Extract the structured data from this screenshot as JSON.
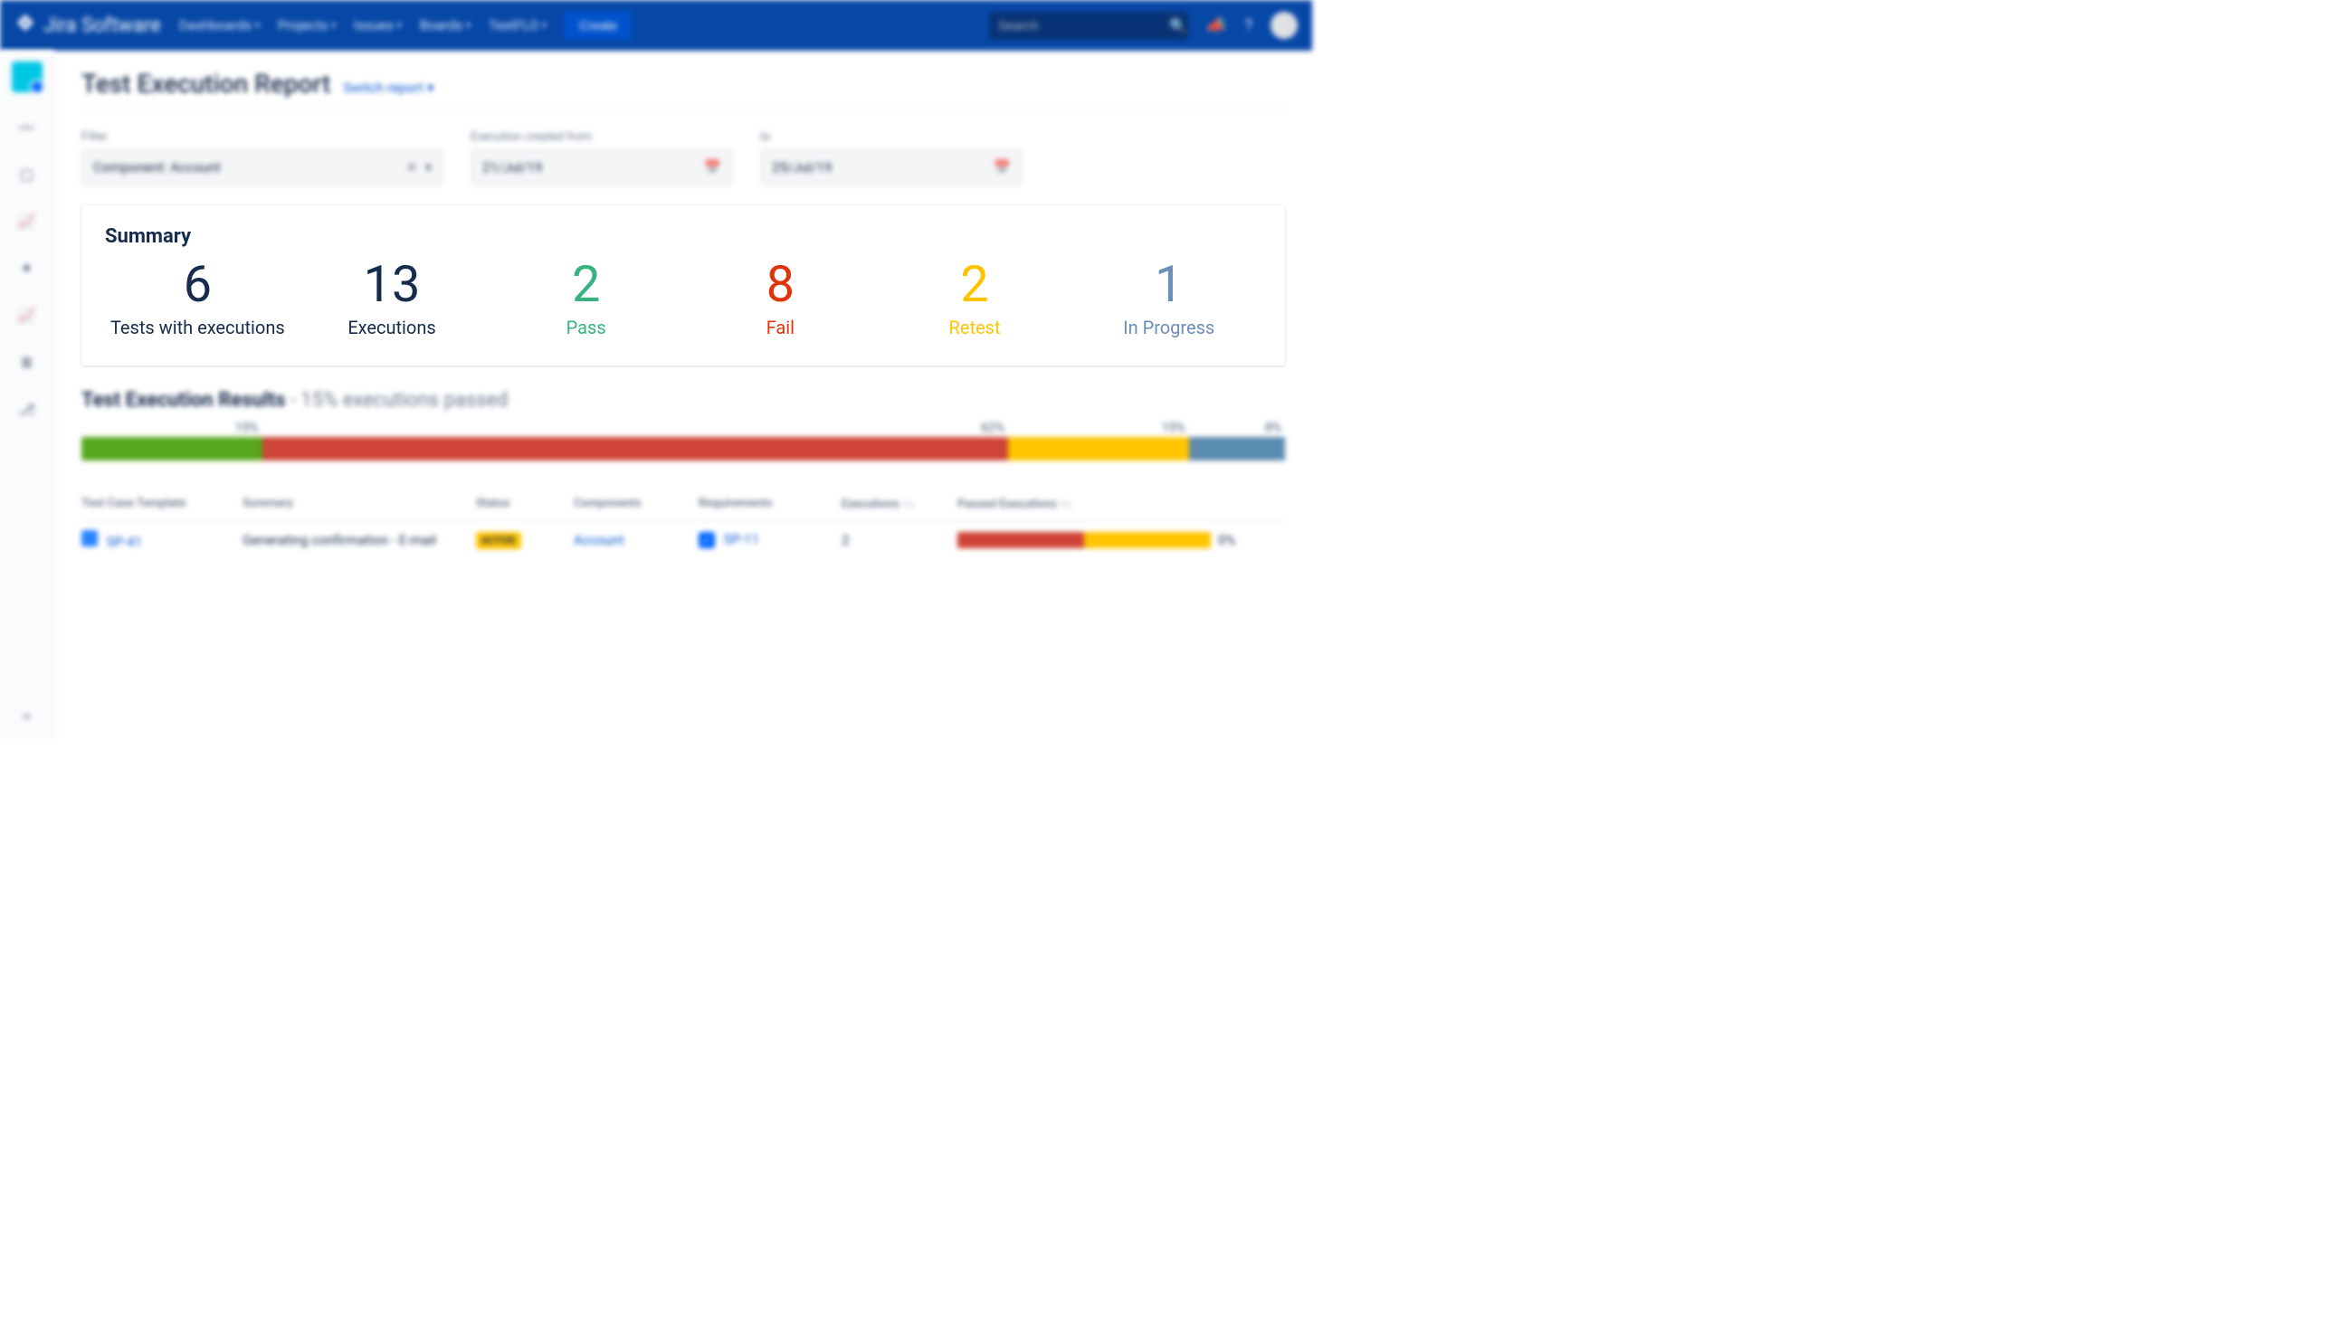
{
  "topbar": {
    "product": "Jira Software",
    "nav": [
      "Dashboards",
      "Projects",
      "Issues",
      "Boards",
      "TestFLO"
    ],
    "create": "Create",
    "search_placeholder": "Search"
  },
  "page": {
    "title": "Test Execution Report",
    "switch": "Switch report"
  },
  "filters": {
    "filter_label": "Filter",
    "filter_value": "Component: Account",
    "from_label": "Execution created from",
    "from_value": "21/Jul/19",
    "to_label": "to",
    "to_value": "25/Jul/19"
  },
  "summary": {
    "title": "Summary",
    "metrics": [
      {
        "value": "6",
        "label": "Tests with executions",
        "cls": "c-black"
      },
      {
        "value": "13",
        "label": "Executions",
        "cls": "c-black"
      },
      {
        "value": "2",
        "label": "Pass",
        "cls": "c-green"
      },
      {
        "value": "8",
        "label": "Fail",
        "cls": "c-red"
      },
      {
        "value": "2",
        "label": "Retest",
        "cls": "c-yellow"
      },
      {
        "value": "1",
        "label": "In Progress",
        "cls": "c-blue"
      }
    ]
  },
  "results": {
    "title": "Test Execution Results",
    "subtitle": "- 15% executions passed",
    "segments": [
      {
        "pct": 15,
        "label": "15%",
        "cls": "green"
      },
      {
        "pct": 62,
        "label": "62%",
        "cls": "red"
      },
      {
        "pct": 15,
        "label": "15%",
        "cls": "yellow"
      },
      {
        "pct": 8,
        "label": "8%",
        "cls": "blue"
      }
    ]
  },
  "table": {
    "headers": [
      "Test Case Template",
      "Summary",
      "Status",
      "Components",
      "Requirements",
      "Executions ↑↓",
      "Passed Executions ↑↓",
      ""
    ],
    "row": {
      "tct": "SP-41",
      "summary": "Generating confirmation - E-mail",
      "status": "ACTIVE",
      "component": "Account",
      "requirement": "SP-11",
      "executions": "2",
      "passed_segments": [
        {
          "pct": 50,
          "cls": "red"
        },
        {
          "pct": 50,
          "cls": "yellow"
        }
      ],
      "passed_pct": "0%"
    }
  },
  "chart_data": {
    "type": "bar",
    "title": "Test Execution Results",
    "categories": [
      "Pass",
      "Fail",
      "Retest",
      "In Progress"
    ],
    "values": [
      15,
      62,
      15,
      8
    ],
    "unit": "percent"
  }
}
